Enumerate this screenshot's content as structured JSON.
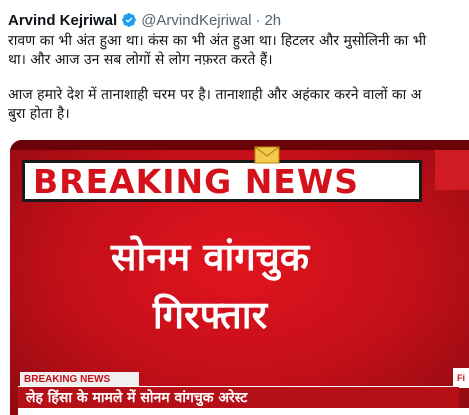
{
  "tweet": {
    "display_name": "Arvind Kejriwal",
    "handle": "@ArvindKejriwal",
    "separator": "·",
    "time": "2h",
    "lines": [
      "रावण का भी अंत हुआ था। कंस का भी अंत हुआ था। हिटलर और मुसोलिनी का भी",
      "था। और आज उन सब लोगों से लोग नफ़रत करते हैं।",
      "आज हमारे देश में तानाशाही चरम पर है। तानाशाही और अहंकार करने वालों का अ",
      "बुरा होता है।"
    ]
  },
  "media": {
    "breaking_banner": "BREAKING NEWS",
    "headline_line1": "सोनम वांगचुक",
    "headline_line2": "गिरफ्तार",
    "ticker_label": "BREAKING NEWS",
    "ticker_text": "लेह हिंसा के मामले में सोनम वांगचुक अरेस्ट",
    "ticker_tag": "Fi"
  },
  "colors": {
    "text": "#0f1419",
    "muted": "#536471",
    "verified": "#1d9bf0",
    "news_red": "#d4121b"
  },
  "icons": {
    "verified": "verified-badge-icon",
    "envelope": "envelope-icon"
  }
}
